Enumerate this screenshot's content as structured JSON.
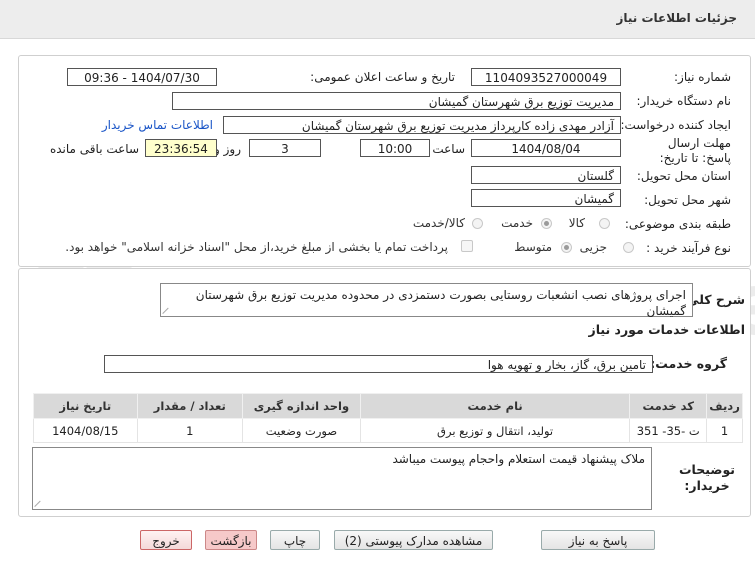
{
  "title": "جزئیات اطلاعات نیاز",
  "watermark": "AriaTender.net",
  "fields": {
    "need_number_label": "شماره نیاز:",
    "need_number": "1104093527000049",
    "announce_label": "تاریخ و ساعت اعلان عمومی:",
    "announce_value": "1404/07/30 - 09:36",
    "buyer_org_label": "نام دستگاه خریدار:",
    "buyer_org": "مدیریت توزیع برق شهرستان گمیشان",
    "creator_label": "ایجاد کننده درخواست:",
    "creator": "آزادر مهدی زاده کارپرداز مدیریت توزیع برق شهرستان گمیشان",
    "contact_link": "اطلاعات تماس خریدار",
    "deadline_label": "مهلت ارسال پاسخ: تا تاریخ:",
    "deadline_date": "1404/08/04",
    "time_label": "ساعت",
    "deadline_time": "10:00",
    "days": "3",
    "days_label": "روز و",
    "remaining": "23:36:54",
    "remaining_label": "ساعت باقی مانده",
    "province_label": "استان محل تحویل:",
    "province": "گلستان",
    "city_label": "شهر محل تحویل:",
    "city": "گمیشان",
    "category_label": "طبقه بندی موضوعی:",
    "category_options": [
      "کالا",
      "خدمت",
      "کالا/خدمت"
    ],
    "category_selected": "خدمت",
    "process_label": "نوع فرآیند خرید :",
    "process_options": [
      "جزیی",
      "متوسط"
    ],
    "process_selected": "متوسط",
    "treasury_note": "پرداخت تمام یا بخشی از مبلغ خرید،از محل \"اسناد خزانه اسلامی\" خواهد بود."
  },
  "description": {
    "label": "شرح کلی نیاز:",
    "text": "اجرای پروژهای نصب انشعبات روستایی بصورت دستمزدی در محدوده مدیریت توزیع برق شهرستان گمیشان"
  },
  "services": {
    "header": "اطلاعات خدمات مورد نیاز",
    "group_label": "گروه خدمت:",
    "group_value": "تامین برق، گاز، بخار و تهویه هوا",
    "columns": [
      "ردیف",
      "کد خدمت",
      "نام خدمت",
      "واحد اندازه گیری",
      "تعداد / مقدار",
      "تاریخ نیاز"
    ],
    "rows": [
      [
        "1",
        "ت -35- 351",
        "تولید، انتقال و توزیع برق",
        "صورت وضعیت",
        "1",
        "1404/08/15"
      ]
    ]
  },
  "notes": {
    "label": "توضیحات خریدار:",
    "text": "ملاک پیشنهاد قیمت استعلام واحجام پیوست میباشد"
  },
  "buttons": {
    "reply": "پاسخ به نیاز",
    "docs": "مشاهده مدارک پیوستی (2)",
    "print": "چاپ",
    "back": "بازگشت",
    "exit": "خروج"
  }
}
